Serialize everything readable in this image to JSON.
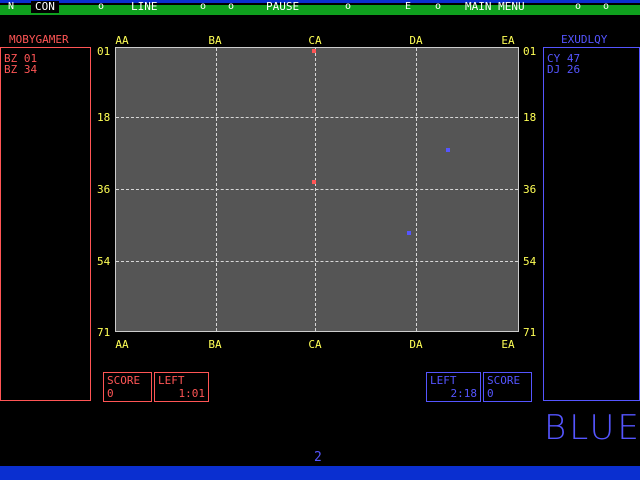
{
  "menu": {
    "items": [
      {
        "label": "CON",
        "name": "con"
      },
      {
        "label": "LINE",
        "name": "line"
      },
      {
        "label": "PAUSE",
        "name": "pause"
      },
      {
        "label": "MAIN MENU",
        "name": "main-menu"
      }
    ]
  },
  "left_player": {
    "name": "MOBYGAMER",
    "moves": [
      "BZ 01",
      "BZ 34"
    ],
    "score_label": "SCORE",
    "score": "0",
    "time_label": "LEFT",
    "time": "1:01"
  },
  "right_player": {
    "name": "EXUDLQY",
    "moves": [
      "CY 47",
      "DJ 26"
    ],
    "score_label": "SCORE",
    "score": "0",
    "time_label": "LEFT",
    "time": "2:18"
  },
  "board": {
    "columns": [
      "AA",
      "BA",
      "CA",
      "DA",
      "EA"
    ],
    "rows": [
      "01",
      "18",
      "36",
      "54",
      "71"
    ],
    "pieces": [
      {
        "team": "red",
        "col": 0.492,
        "row": 0.012
      },
      {
        "team": "red",
        "col": 0.492,
        "row": 0.475
      },
      {
        "team": "blue",
        "col": 0.825,
        "row": 0.362
      },
      {
        "team": "blue",
        "col": 0.73,
        "row": 0.655
      }
    ],
    "colors": {
      "red": "#ff5555",
      "blue": "#5555ff",
      "bg": "#555555"
    }
  },
  "turn_team": "BLUE",
  "page": "2"
}
